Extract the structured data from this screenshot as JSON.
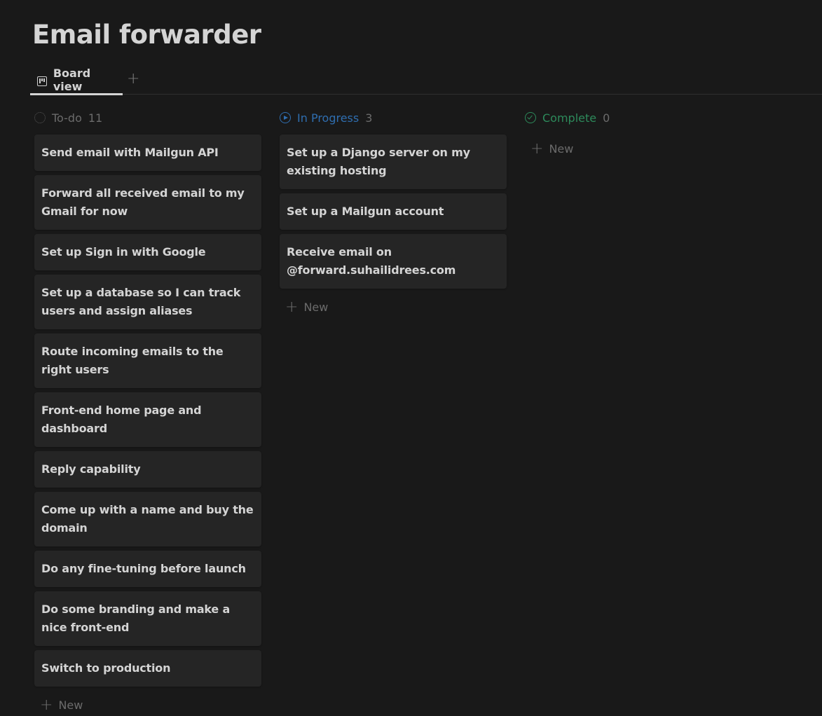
{
  "page": {
    "title": "Email forwarder"
  },
  "views": {
    "tabs": [
      {
        "label": "Board view",
        "icon": "board-icon",
        "active": true
      }
    ],
    "add_view_label": "+"
  },
  "board": {
    "new_label": "New",
    "columns": [
      {
        "name": "To-do",
        "count": "11",
        "color": "#6b6b6b",
        "icon": "status-todo-icon",
        "cards": [
          "Send email with Mailgun API",
          "Forward all received email to my Gmail for now",
          "Set up Sign in with Google",
          "Set up a database so I can track users and assign aliases",
          "Route incoming emails to the right users",
          "Front-end home page and dashboard",
          "Reply capability",
          "Come up with a name and buy the domain",
          "Do any fine-tuning before launch",
          "Do some branding and make a nice front-end",
          "Switch to production"
        ]
      },
      {
        "name": "In Progress",
        "count": "3",
        "color": "#2f6eb0",
        "icon": "status-in-progress-icon",
        "cards": [
          "Set up a Django server on my existing hosting",
          "Set up a Mailgun account",
          "Receive email on @forward.suhailidrees.com"
        ]
      },
      {
        "name": "Complete",
        "count": "0",
        "color": "#2d8a5b",
        "icon": "status-complete-icon",
        "cards": []
      }
    ]
  }
}
